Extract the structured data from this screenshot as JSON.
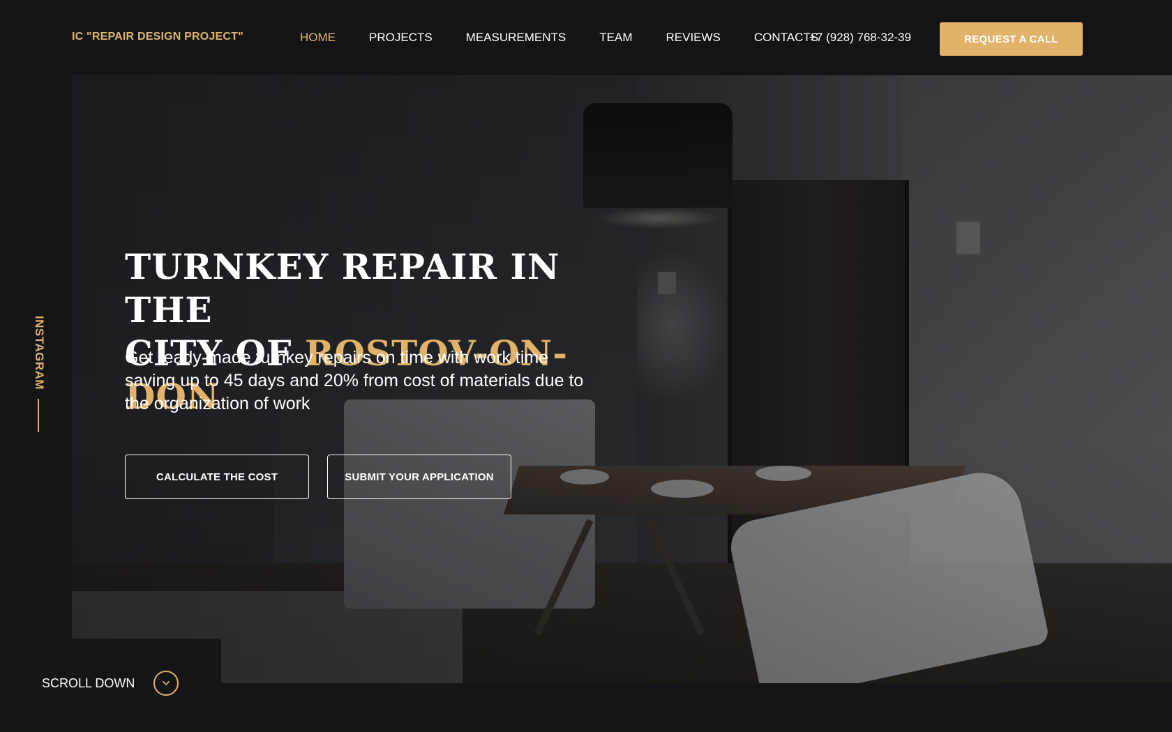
{
  "header": {
    "logo": "IC \"REPAIR DESIGN PROJECT\"",
    "nav": [
      {
        "label": "HOME",
        "active": true
      },
      {
        "label": "PROJECTS"
      },
      {
        "label": "MEASUREMENTS"
      },
      {
        "label": "TEAM"
      },
      {
        "label": "REVIEWS"
      },
      {
        "label": "CONTACTS"
      }
    ],
    "phone": "+7 (928) 768-32-39",
    "cta_label": "REQUEST A CALL"
  },
  "hero": {
    "title_line1": "TURNKEY REPAIR IN THE",
    "title_line2_prefix": "CITY OF ",
    "title_accent": "ROSTOV-ON-DON",
    "description": "Get ready-made turnkey repairs on time with work time saving up to 45 days and 20% from cost of materials due to the organization of work",
    "btn_calculate": "CALCULATE THE COST",
    "btn_submit": "SUBMIT YOUR APPLICATION"
  },
  "side": {
    "instagram": "INSTAGRAM"
  },
  "scroll": {
    "label": "SCROLL DOWN",
    "icon": "chevron-down-icon"
  },
  "colors": {
    "accent": "#e1b26a",
    "background": "#151517",
    "text": "#ffffff"
  }
}
